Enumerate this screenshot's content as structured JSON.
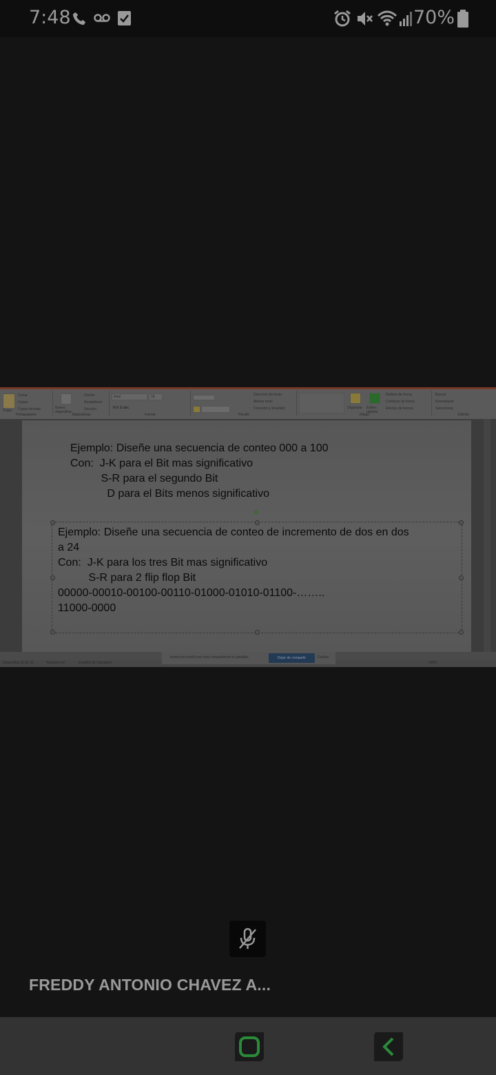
{
  "status_bar": {
    "time": "7:48",
    "battery": "70%",
    "left_icons": [
      "phone-icon",
      "voicemail-icon",
      "checkbox-icon"
    ],
    "right_icons": [
      "alarm-icon",
      "mute-icon",
      "wifi-icon",
      "signal-icon",
      "battery-icon"
    ]
  },
  "ribbon": {
    "portapapeles": {
      "paste": "Pegar",
      "cut": "Cortar",
      "copy": "Copiar",
      "format": "Copiar formato",
      "label": "Portapapeles"
    },
    "diapositivas": {
      "new": "Nueva diapositiva",
      "layout": "Diseño",
      "reset": "Restablecer",
      "section": "Sección",
      "label": "Diapositivas"
    },
    "fuente": {
      "font": "Arial",
      "size": "18",
      "label": "Fuente"
    },
    "parrafo": {
      "dir": "Dirección del texto",
      "align": "Alinear texto",
      "smartart": "Convertir a SmartArt",
      "label": "Párrafo"
    },
    "dibujo": {
      "arrange": "Organizar",
      "styles": "Estilos rápidos",
      "fill": "Relleno de forma",
      "outline": "Contorno de forma",
      "effects": "Efectos de formas",
      "label": "Dibujo"
    },
    "edicion": {
      "find": "Buscar",
      "replace": "Reemplazar",
      "select": "Seleccionar",
      "label": "Edición"
    }
  },
  "slide": {
    "block1": [
      "Ejemplo: Diseñe una secuencia de conteo 000 a 100",
      "Con:  J-K para el Bit mas significativo",
      "          S-R para el segundo Bit",
      "            D para el Bits menos significativo"
    ],
    "block2": [
      "Ejemplo: Diseñe una secuencia de conteo de incremento de dos en dos",
      "a 24",
      "Con:  J-K para los tres Bit mas significativo",
      "          S-R para 2 flip flop Bit",
      "00000-00010-00100-00110-01000-01010-01100-……..",
      "11000-0000"
    ]
  },
  "share_banner": {
    "text": "teams.microsoft.com está compartiendo tu pantalla.",
    "stop": "Dejar de compartir",
    "hide": "Ocultar"
  },
  "app_status": {
    "slide_info": "Diapositiva 11 de 32",
    "theme": "\"Adyacencia\"",
    "language": "Español (El Salvador)",
    "zoom": "100%"
  },
  "participant": {
    "name": "FREDDY ANTONIO CHAVEZ A..."
  },
  "colors": {
    "background": "#141414",
    "ribbon_accent": "#7a3a2a",
    "nav_green": "#2a8a3a"
  }
}
